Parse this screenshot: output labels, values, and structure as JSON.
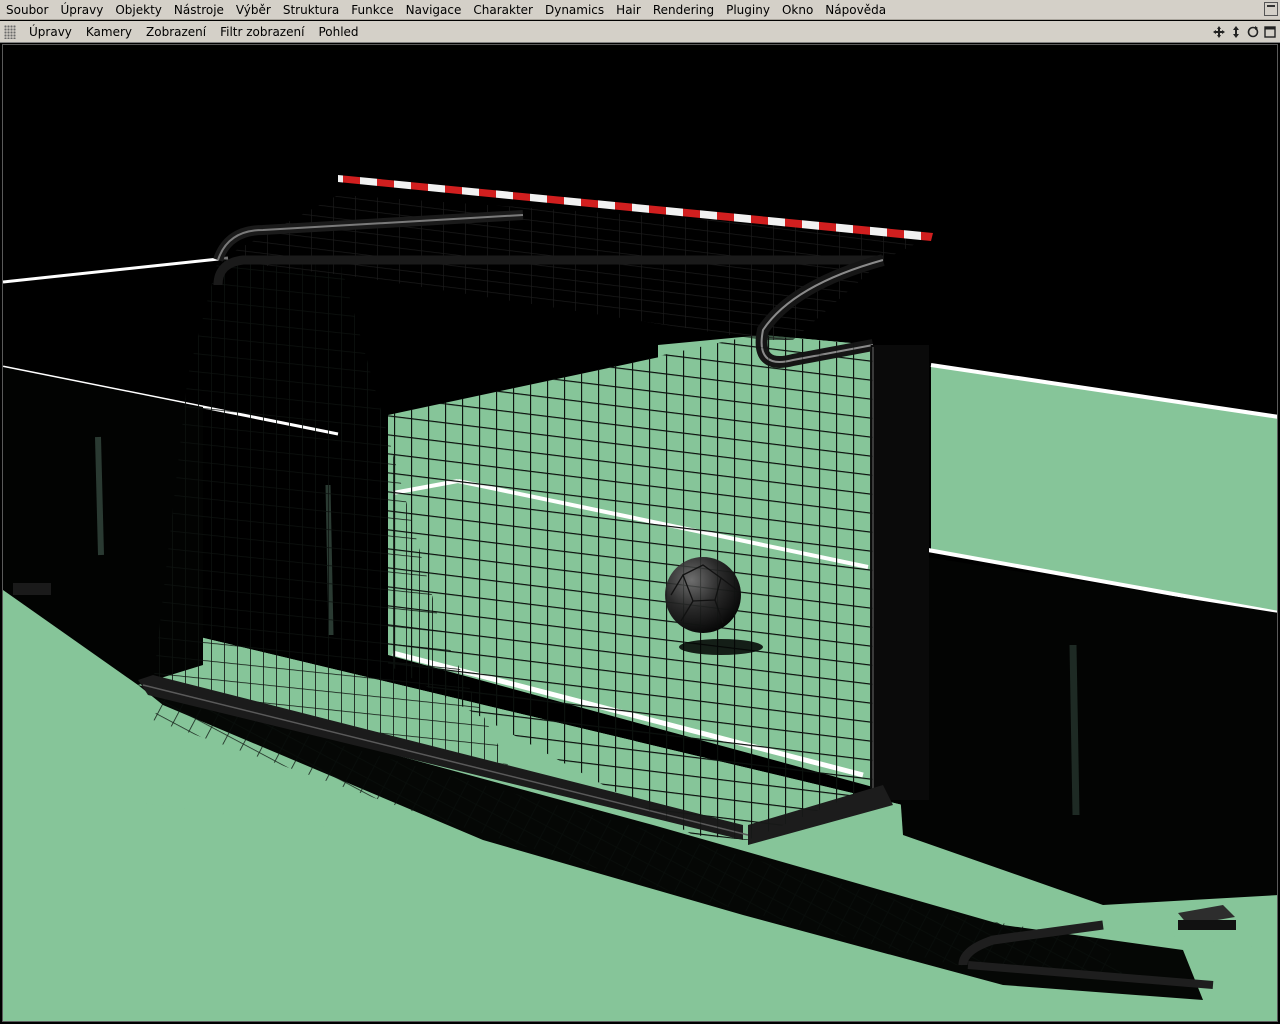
{
  "app": {
    "menu": [
      "Soubor",
      "Úpravy",
      "Objekty",
      "Nástroje",
      "Výběr",
      "Struktura",
      "Funkce",
      "Navigace",
      "Charakter",
      "Dynamics",
      "Hair",
      "Rendering",
      "Pluginy",
      "Okno",
      "Nápověda"
    ],
    "window_icon": "window-menu-icon"
  },
  "viewport_menu": [
    "Úpravy",
    "Kamery",
    "Zobrazení",
    "Filtr zobrazení",
    "Pohled"
  ],
  "nav_icons": [
    "move-view-icon",
    "dolly-view-icon",
    "rotate-view-icon",
    "maximize-view-icon"
  ],
  "scene": {
    "description_objects": [
      "soccer-goal",
      "goal-net",
      "soccer-ball",
      "pitch"
    ],
    "colors": {
      "pitch": "#86c599",
      "background": "#000000",
      "line": "#ffffff",
      "net": "#0d120f",
      "crossbar_red": "#d11f1f"
    }
  }
}
